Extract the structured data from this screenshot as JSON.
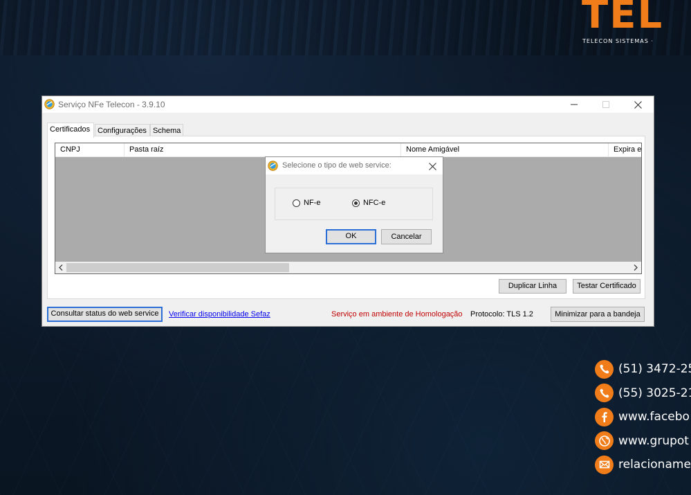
{
  "brand": {
    "word": "TEL",
    "tagline": "TELECON SISTEMAS  ·  ",
    "accent_color": "#f07d1a"
  },
  "contacts": [
    {
      "icon": "phone-icon",
      "text": "(51) 3472-25"
    },
    {
      "icon": "phone-icon",
      "text": "(55) 3025-21"
    },
    {
      "icon": "facebook-icon",
      "text": "www.facebo"
    },
    {
      "icon": "globe-icon",
      "text": "www.grupot"
    },
    {
      "icon": "mail-icon",
      "text": "relacioname"
    }
  ],
  "window": {
    "title": "Serviço NFe Telecon - 3.9.10",
    "controls": {
      "minimize": "minimize-icon",
      "maximize": "maximize-icon",
      "close": "close-icon"
    }
  },
  "tabs": [
    {
      "label": "Certificados",
      "active": true
    },
    {
      "label": "Configurações",
      "active": false
    },
    {
      "label": "Schema",
      "active": false
    }
  ],
  "grid": {
    "columns": [
      "CNPJ",
      "Pasta raíz",
      "Nome Amigável",
      "Expira em"
    ],
    "rows": []
  },
  "panel_buttons": {
    "duplicate": "Duplicar Linha",
    "test_cert": "Testar Certificado"
  },
  "footer": {
    "check_status": "Consultar status do web service",
    "verify_link": "Verificar disponibilidade Sefaz",
    "environment": "Serviço em ambiente de Homologação",
    "protocol": "Protocolo: TLS 1.2",
    "minimize_tray": "Minimizar para a bandeja"
  },
  "dialog": {
    "title": "Selecione o tipo de web service:",
    "options": [
      {
        "label": "NF-e",
        "selected": false
      },
      {
        "label": "NFC-e",
        "selected": true
      }
    ],
    "ok": "OK",
    "cancel": "Cancelar"
  }
}
